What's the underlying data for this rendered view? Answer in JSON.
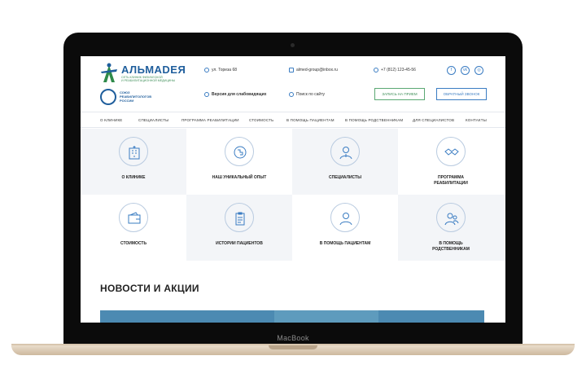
{
  "device": {
    "label": "MacBook"
  },
  "header": {
    "logo_name": "АЛЬМАDЕЯ",
    "logo_sub": "СЕТЬ КЛИНИК ФИЗИЧЕСКОЙ\nИ РЕАБИЛИТАЦИОННОЙ МЕДИЦИНЫ",
    "rehab_text": "СОЮЗ\nРЕАБИЛИТОЛОГОВ\nРОССИИ",
    "address": "ул. Тореза 68",
    "email": "almed-group@inbox.ru",
    "phone": "+7 (812) 123-45-56",
    "accessibility": "Версия для слабовидящих",
    "search": "Поиск по сайту",
    "appointment_button": "ЗАПИСЬ НА ПРИЕМ",
    "callback_button": "ОБРАТНЫЙ ЗВОНОК",
    "socials": [
      "f",
      "vk",
      "◎"
    ]
  },
  "nav": {
    "items": [
      "О КЛИНИКЕ",
      "СПЕЦИАЛИСТЫ",
      "ПРОГРАММА РЕАБИЛИТАЦИИ",
      "СТОИМОСТЬ",
      "В ПОМОЩЬ ПАЦИЕНТАМ",
      "В ПОМОЩЬ РОДСТВЕННИКАМ",
      "ДЛЯ СПЕЦИАЛИСТОВ",
      "КОНТАКТЫ"
    ]
  },
  "tiles": [
    {
      "label": "О КЛИНИКЕ",
      "icon": "building-icon"
    },
    {
      "label": "НАШ УНИКАЛЬНЫЙ ОПЫТ",
      "icon": "puzzle-head-icon"
    },
    {
      "label": "СПЕЦИАЛИСТЫ",
      "icon": "doctor-icon"
    },
    {
      "label": "ПРОГРАММА\nРЕАБИЛИТАЦИИ",
      "icon": "handshake-icon"
    },
    {
      "label": "СТОИМОСТЬ",
      "icon": "wallet-icon"
    },
    {
      "label": "ИСТОРИИ ПАЦИЕНТОВ",
      "icon": "clipboard-icon"
    },
    {
      "label": "В ПОМОЩЬ ПАЦИЕНТАМ",
      "icon": "patient-icon"
    },
    {
      "label": "В ПОМОЩЬ\nРОДСТВЕННИКАМ",
      "icon": "family-help-icon"
    }
  ],
  "news": {
    "title": "НОВОСТИ И АКЦИИ"
  },
  "colors": {
    "brand_blue": "#1f5e9c",
    "brand_green": "#3f8f59",
    "accent_blue": "#3a7cc2",
    "banner": "#4c8ab2"
  }
}
